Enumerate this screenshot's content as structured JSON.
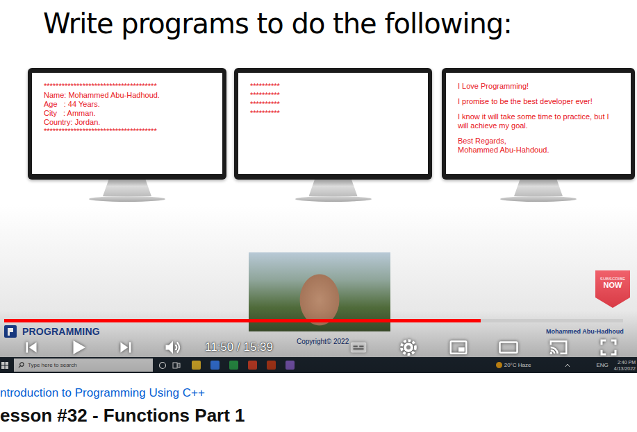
{
  "slide": {
    "title": "Write programs to do the following:",
    "monitors": [
      {
        "paragraphs": [
          [
            "**************************************",
            "Name: Mohammed Abu-Hadhoud.",
            "Age   : 44 Years.",
            "City   : Amman.",
            "Country: Jordan.",
            "**************************************"
          ]
        ]
      },
      {
        "paragraphs": [
          [
            "**********",
            "**********",
            "**********",
            "**********"
          ]
        ]
      },
      {
        "paragraphs": [
          [
            "I Love Programming!"
          ],
          [
            "I promise to be the best developer ever!"
          ],
          [
            "I know it will take some time to practice, but I will achieve my goal."
          ],
          [
            "Best Regards,",
            "Mohammed Abu-Hahdoud."
          ]
        ]
      }
    ]
  },
  "badge": {
    "top": "SUBSCRIBE",
    "bottom": "NOW"
  },
  "watermark": {
    "logo": "PROGRAMMING",
    "copyright": "Copyright© 2022",
    "author": "Mohammed Abu-Hadhoud"
  },
  "player": {
    "progress": {
      "level": 0.77
    },
    "time": "11:50 / 15:39"
  },
  "taskbar": {
    "search_placeholder": "Type here to search",
    "apps": [
      {
        "color": "#f2c12e"
      },
      {
        "color": "#3b82f6"
      },
      {
        "color": "#2ea44f"
      },
      {
        "color": "#d9442a"
      },
      {
        "color": "#c43e1c"
      },
      {
        "color": "#865fc5"
      }
    ],
    "weather": "20°C Haze",
    "language": "ENG",
    "time": "2:40 PM",
    "date": "4/13/2022"
  },
  "video": {
    "playlist": "ntroduction to Programming Using C++",
    "title": "esson #32 - Functions Part 1"
  }
}
